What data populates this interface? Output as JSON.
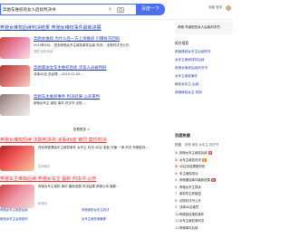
{
  "search": {
    "query": "奔驰车维权的女人后续判决书",
    "button": "百度一下"
  },
  "header": {
    "right": "收藏 登录"
  },
  "results": [
    {
      "title": "奔驰女维权后续判决结果 奔驰女维权事件最新进展",
      "desc": ""
    },
    {
      "title": "奔驰女维权 为什么后一方上诉维权 引爆各方回响",
      "desc": "2019年4月... 西安奔驰女车主维权事件后续 判决... 法院判决书公开。",
      "source": "搜狐 网易 新浪"
    },
    {
      "title": "奔驰漏油女车主维权后续 涉案人员被判刑",
      "desc": "涉事4S店 总经理... 2019-12-20..."
    },
    {
      "title": "奔驰车主维权事件 判决结果 公开审判",
      "desc": "奔驰女车主 维权 事件 判决书 法院..."
    },
    {
      "title": "奔驰漏油女车主 奔驰维权后续 女车主获赔",
      "desc": "..."
    }
  ],
  "more": "查看更多 >",
  "big": [
    {
      "title": "奔驰女维权后续 法院判决书 涉事4S店 被罚 案件判决",
      "desc": "西安奔驰漏油车主维权事件 女车主 判决 4S店 老板 诈骗 一审 判决 有期徒刑...",
      "source": "澎湃新闻"
    },
    {
      "title": "奔驰车主维权后续 奔驰女车主 最新 判决书 公开",
      "desc": "奔驰女车主维权 事件 最新进展 判决结果 奔驰公司 道歉...",
      "source": "新浪网"
    }
  ],
  "related_search_box": "奔驰 车维权的女人后续判决书",
  "related_label": "相关搜索",
  "related": [
    "奔驰维权女车主后续判决",
    "女车主维权成功后续",
    "奔驰女维权后续判决书",
    "女车主维权事件",
    "维权女车主 后续",
    "奔驰维权女主 现状"
  ],
  "hot": {
    "title": "百度热搜",
    "tabs": [
      "热搜",
      "奔驰 维权 女车主 判决书"
    ],
    "items": [
      {
        "n": "1",
        "text": "奔驰女车主维权后续",
        "tag": "热"
      },
      {
        "n": "2",
        "text": "女车主维权判决",
        "tag": "新"
      },
      {
        "n": "3",
        "text": "4S店总经理被判刑",
        "tag": ""
      },
      {
        "n": "4",
        "text": "车主维权成功",
        "tag": ""
      },
      {
        "n": "5",
        "text": "奔驰漏油事件最新进展",
        "tag": "热"
      },
      {
        "n": "6",
        "text": "奔驰女车主现状",
        "tag": ""
      },
      {
        "n": "7",
        "text": "维权车主获赔偿",
        "tag": ""
      },
      {
        "n": "8",
        "text": "法院判决书公开",
        "tag": ""
      },
      {
        "n": "9",
        "text": "涉事4S店被罚",
        "tag": ""
      },
      {
        "n": "10",
        "text": "奔驰回应维权事件",
        "tag": ""
      },
      {
        "n": "11",
        "text": "女车主维权案判决",
        "tag": ""
      },
      {
        "n": "12",
        "text": "奔驰事件后续",
        "tag": ""
      }
    ]
  },
  "bottom_related": [
    "奔驰女车主维权后续",
    "奔驰维权女车主判决",
    "维权女车主后续如何",
    "女车主维权案最新"
  ],
  "colors": {
    "accent": "#4e6ef2",
    "link": "#2440b3",
    "red": "#f73131"
  }
}
